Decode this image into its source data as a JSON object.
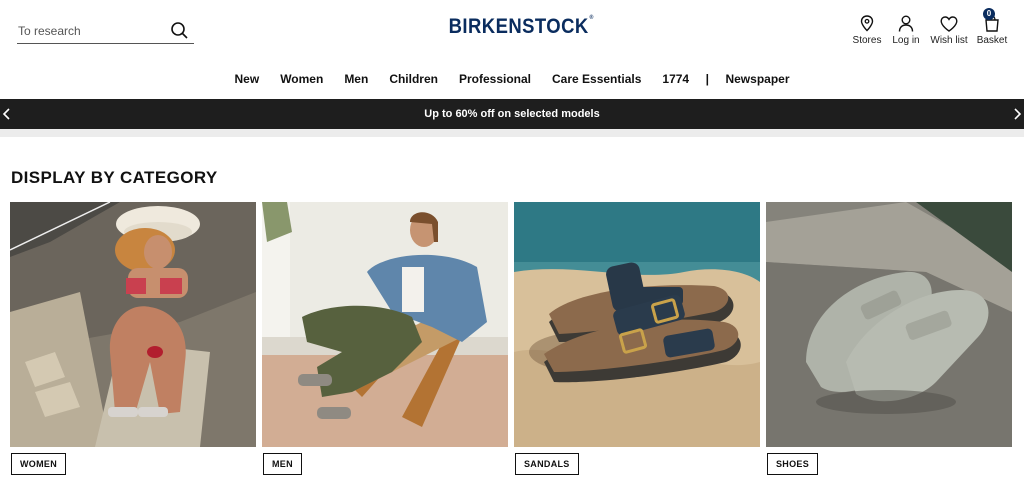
{
  "search": {
    "placeholder": "To research"
  },
  "brand": {
    "name": "BIRKENSTOCK",
    "mark": "®"
  },
  "actions": {
    "stores": "Stores",
    "login": "Log in",
    "wishlist": "Wish list",
    "basket": "Basket",
    "basket_count": "0"
  },
  "nav": {
    "items": [
      "New",
      "Women",
      "Men",
      "Children",
      "Professional",
      "Care Essentials",
      "1774"
    ],
    "separator": "|",
    "after_separator": "Newspaper"
  },
  "promo": {
    "text": "Up to 60% off on selected models"
  },
  "section": {
    "title": "DISPLAY BY CATEGORY"
  },
  "categories": [
    {
      "label": "WOMEN"
    },
    {
      "label": "MEN"
    },
    {
      "label": "SANDALS"
    },
    {
      "label": "SHOES"
    }
  ],
  "colors": {
    "brand": "#0a2c5e",
    "promo_bg": "#1e1e1e"
  }
}
